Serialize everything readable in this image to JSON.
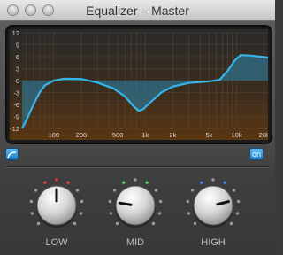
{
  "window": {
    "title": "Equalizer – Master"
  },
  "graph": {
    "y_ticks": [
      "12",
      "9",
      "6",
      "3",
      "0",
      "-3",
      "-6",
      "-9",
      "-12"
    ],
    "x_ticks": [
      "100",
      "200",
      "500",
      "1k",
      "2k",
      "5k",
      "10k",
      "20k"
    ]
  },
  "controls": {
    "shape_button": "filter-shape-icon",
    "on_label": "on"
  },
  "knobs": [
    {
      "label": "LOW",
      "value": 0.5,
      "indicator": "red"
    },
    {
      "label": "MID",
      "value": 0.2,
      "indicator": "green"
    },
    {
      "label": "HIGH",
      "value": 0.78,
      "indicator": "blue"
    }
  ],
  "colors": {
    "curve": "#35b5e8",
    "fill": "#2f6f8a",
    "indicator_red": "#e0473c",
    "indicator_green": "#56d15a",
    "indicator_blue": "#3f8bf0"
  }
}
